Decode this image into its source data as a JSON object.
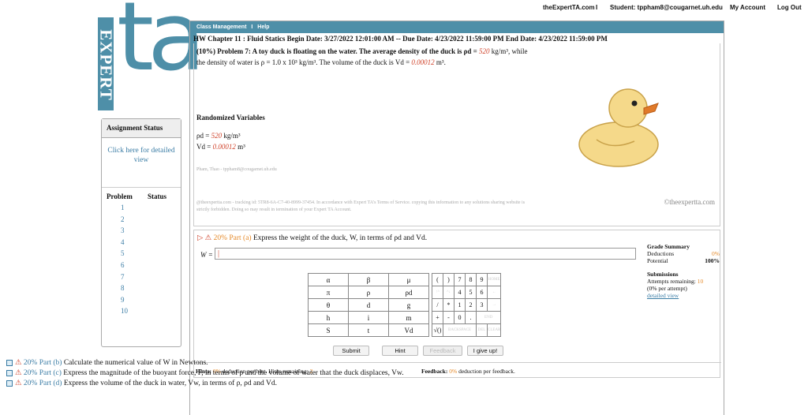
{
  "topbar": {
    "site": "theExpertTA.com",
    "sep": "I",
    "student": "Student: tppham8@cougarnet.uh.edu",
    "account": "My Account",
    "logout": "Log Out"
  },
  "logo": {
    "vertical": "EXPERT",
    "mark": "ta"
  },
  "sidebar": {
    "status_title": "Assignment Status",
    "detail_link": "Click here for detailed view",
    "col_problem": "Problem",
    "col_status": "Status",
    "problems": [
      "1",
      "2",
      "3",
      "4",
      "5",
      "6",
      "7",
      "8",
      "9",
      "10"
    ]
  },
  "menu": {
    "class_mgmt": "Class Management",
    "sep": "I",
    "help": "Help"
  },
  "hw_title": "HW Chapter 11 : Fluid Statics Begin Date: 3/27/2022 12:01:00 AM -- Due Date: 4/23/2022 11:59:00 PM End Date: 4/23/2022 11:59:00 PM",
  "problem": {
    "intro": "(10%) Problem 7: A toy duck is floating on the water. The average density of the duck is ρd = ",
    "rho_d": "520",
    "mid": " kg/m³, while the density of water is ρ = 1.0 x 10³ kg/m³. The volume of the duck is Vd = ",
    "v_d": "0.00012",
    "end": " m³.",
    "rv_title": "Randomized Variables",
    "rv1_label": "ρd = ",
    "rv1_val": "520",
    "rv1_unit": " kg/m³",
    "rv2_label": "Vd = ",
    "rv2_val": "0.00012",
    "rv2_unit": " m³",
    "owner": "Pham, Thao - tppham8@cougarnet.uh.edu",
    "tracking": "@theexpertta.com - tracking id: 5TR8-6A-C7-40-8999-37454. In accordance with Expert TA's Terms of Service. copying this information to any solutions sharing website is strictly forbidden. Doing so may result in termination of your Expert TA Account.",
    "copyright": "©theexpertta.com"
  },
  "part_a": {
    "percent": "20% Part (a)",
    "question": " Express the weight of the duck, W, in terms of ρd and Vd.",
    "eq_label": "W =",
    "value": ""
  },
  "grade": {
    "title": "Grade Summary",
    "ded_label": "Deductions",
    "ded_val": "0%",
    "pot_label": "Potential",
    "pot_val": "100%",
    "sub_title": "Submissions",
    "remain_label": "Attempts remaining: ",
    "remain_val": "10",
    "per_attempt": "(0% per attempt)",
    "detail": "detailed view"
  },
  "keypad": [
    [
      "α",
      "β",
      "μ"
    ],
    [
      "π",
      "ρ",
      "ρd"
    ],
    [
      "θ",
      "d",
      "g"
    ],
    [
      "h",
      "i",
      "m"
    ],
    [
      "S",
      "t",
      "Vd"
    ]
  ],
  "numpad": {
    "r1": [
      "(",
      ")",
      "7",
      "8",
      "9",
      "HOME"
    ],
    "r2": [
      "↑^",
      "^↓",
      "4",
      "5",
      "6",
      "←"
    ],
    "r3": [
      "/",
      "*",
      "1",
      "2",
      "3",
      "→"
    ],
    "r4": [
      "+",
      "-",
      "0",
      ".",
      "END"
    ],
    "r5": [
      "√()",
      "BACKSPACE",
      "DEL",
      "CLEAR"
    ]
  },
  "buttons": {
    "submit": "Submit",
    "hint": "Hint",
    "feedback": "Feedback",
    "giveup": "I give up!"
  },
  "hints": {
    "label": "Hints: ",
    "pct": "0%",
    "text": " deduction per hint. Hints remaining: ",
    "remain": "2"
  },
  "feedback": {
    "label": "Feedback: ",
    "pct": "0%",
    "text": " deduction per feedback."
  },
  "other_parts": [
    {
      "pct": "20% Part (b)",
      "q": " Calculate the numerical value of W in Newtons."
    },
    {
      "pct": "20% Part (c)",
      "q": " Express the magnitude of the buoyant force, F, in terms of ρ and the volume of water that the duck displaces, Vw."
    },
    {
      "pct": "20% Part (d)",
      "q": " Express the volume of the duck in water, Vw, in terms of ρ, ρd and Vd."
    }
  ],
  "colors": {
    "brand": "#4e8fa8",
    "red": "#d0432b",
    "link": "#3a7ca5",
    "orange": "#e58a2a",
    "duck": "#f5d98a"
  }
}
